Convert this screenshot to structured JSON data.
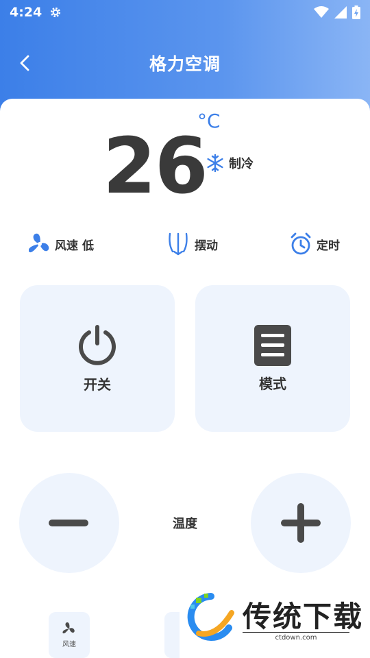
{
  "status": {
    "time": "4:24"
  },
  "header": {
    "title": "格力空调"
  },
  "temperature": {
    "value": "26",
    "unit": "°C"
  },
  "mode_indicator": {
    "label": "制冷"
  },
  "functions": {
    "fan": {
      "label": "风速",
      "value": "低"
    },
    "swing": {
      "label": "摆动"
    },
    "timer": {
      "label": "定时"
    }
  },
  "buttons": {
    "power": {
      "label": "开关"
    },
    "mode": {
      "label": "模式"
    },
    "temp_label": "温度",
    "fan_small": {
      "label": "风速"
    }
  },
  "watermark": {
    "title": "传统下载",
    "url": "ctdown.com"
  },
  "colors": {
    "accent": "#3c7fe8",
    "card_bg": "#eef4fd",
    "text": "#333333"
  }
}
